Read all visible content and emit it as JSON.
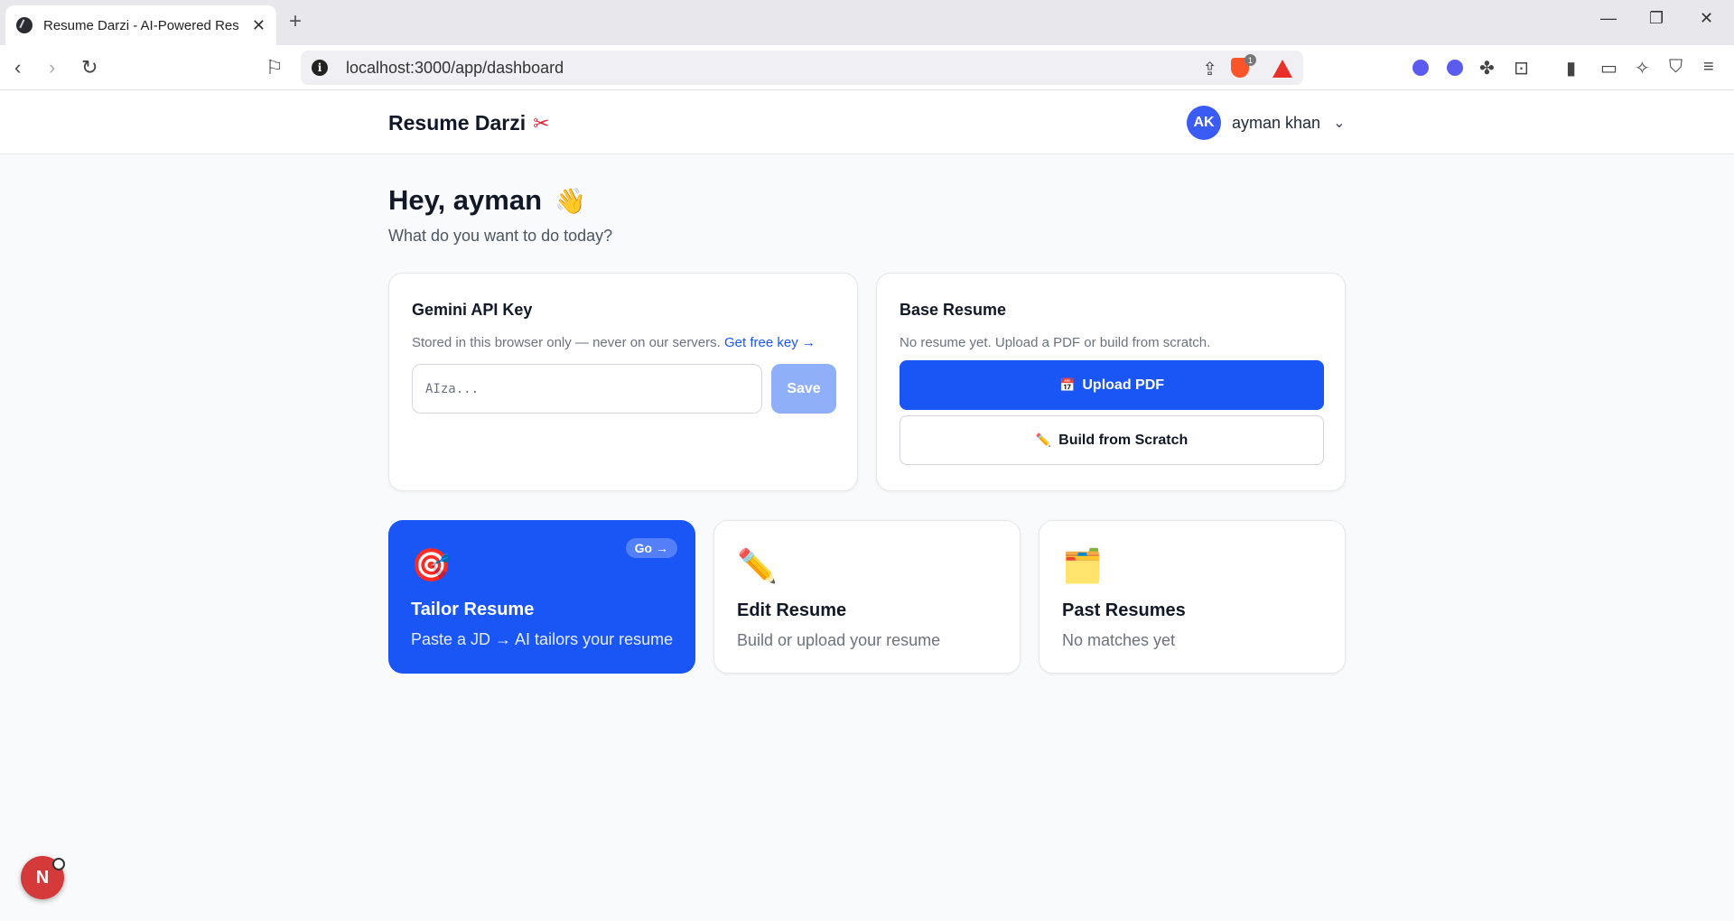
{
  "browser": {
    "tab_title": "Resume Darzi - AI-Powered Resu",
    "url": "localhost:3000/app/dashboard",
    "brave_badge": "1"
  },
  "header": {
    "brand": "Resume Darzi",
    "brand_icon": "scissors-icon",
    "user_initials": "AK",
    "user_name": "ayman khan"
  },
  "main": {
    "greeting": "Hey, ayman",
    "greeting_icon": "waving-hand-icon",
    "subtitle": "What do you want to do today?"
  },
  "api_card": {
    "title": "Gemini API Key",
    "desc": "Stored in this browser only — never on our servers.",
    "link": "Get free key →",
    "placeholder": "AIza...",
    "save_label": "Save"
  },
  "resume_card": {
    "title": "Base Resume",
    "desc": "No resume yet. Upload a PDF or build from scratch.",
    "upload_label": "Upload PDF",
    "build_label": "Build from Scratch"
  },
  "actions": [
    {
      "title": "Tailor Resume",
      "desc": "Paste a JD → AI tailors your resume",
      "badge": "Go →",
      "icon": "target-icon"
    },
    {
      "title": "Edit Resume",
      "desc": "Build or upload your resume",
      "icon": "pencil-icon"
    },
    {
      "title": "Past Resumes",
      "desc": "No matches yet",
      "icon": "folder-icon"
    }
  ],
  "dev_badge": "N",
  "colors": {
    "accent": "#1a56f6",
    "avatar": "#3b5bf5",
    "save_disabled": "#8fb0f8",
    "background": "#f9fafb"
  }
}
